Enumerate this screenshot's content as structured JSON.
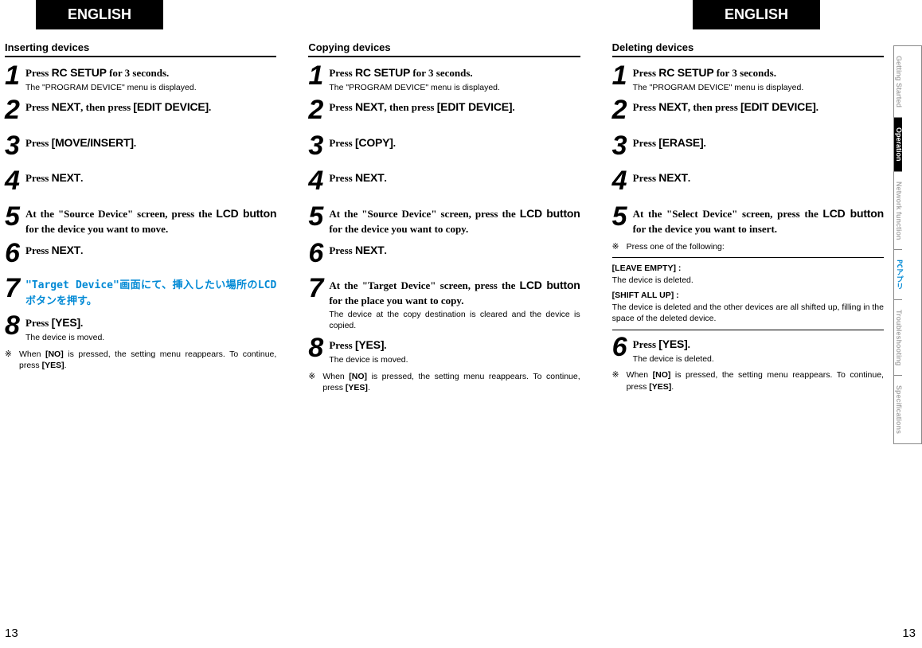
{
  "langLabel": "ENGLISH",
  "pageNumber": "13",
  "sidetabs": [
    {
      "label": "Getting Started",
      "cls": "faded"
    },
    {
      "label": "Operation",
      "cls": "active"
    },
    {
      "label": "Network function",
      "cls": "faded"
    },
    {
      "label": "PCアプリ",
      "cls": "pc"
    },
    {
      "label": "Troubleshooting",
      "cls": "faded"
    },
    {
      "label": "Specifications",
      "cls": "faded"
    }
  ],
  "col1": {
    "title": "Inserting devices",
    "s1_main": "Press RC SETUP for 3 seconds.",
    "s1_sub": "The \"PROGRAM DEVICE\" menu is displayed.",
    "s2_main": "Press NEXT, then press [EDIT DEVICE].",
    "s3_main": "Press [MOVE/INSERT].",
    "s4_main": "Press NEXT.",
    "s5_main": "At the \"Source Device\" screen, press the LCD button for the device you want to move.",
    "s6_main": "Press NEXT.",
    "s7_jp": "\"Target Device\"画面にて、挿入したい場所のLCDボタンを押す。",
    "s8_main": "Press [YES].",
    "s8_sub": "The device is moved.",
    "note": "When [NO] is pressed, the setting menu reappears. To continue, press [YES]."
  },
  "col2": {
    "title": "Copying devices",
    "s1_main": "Press RC SETUP for 3 seconds.",
    "s1_sub": "The \"PROGRAM DEVICE\" menu is displayed.",
    "s2_main": "Press NEXT, then press [EDIT DEVICE].",
    "s3_main": "Press [COPY].",
    "s4_main": "Press NEXT.",
    "s5_main": "At the \"Source Device\" screen, press the LCD button for the device you want to copy.",
    "s6_main": "Press NEXT.",
    "s7_main": "At the \"Target Device\" screen, press the LCD button for the place you want to copy.",
    "s7_sub": "The device at the copy destination is cleared and the device is copied.",
    "s8_main": "Press [YES].",
    "s8_sub": "The device is moved.",
    "note": "When [NO] is pressed, the setting menu reappears. To continue, press [YES]."
  },
  "col3": {
    "title": "Deleting devices",
    "s1_main": "Press RC SETUP for 3 seconds.",
    "s1_sub": "The \"PROGRAM DEVICE\" menu is displayed.",
    "s2_main": "Press NEXT, then press [EDIT DEVICE].",
    "s3_main": "Press [ERASE].",
    "s4_main": "Press NEXT.",
    "s5_main": "At the \"Select Device\" screen, press the LCD button for the device you want to insert.",
    "optnote": "Press one of the following:",
    "opt1_label": "[LEAVE EMPTY] :",
    "opt1_text": "The device is deleted.",
    "opt2_label": "[SHIFT ALL UP] :",
    "opt2_text": "The device is deleted and the other devices are all shifted up, filling in the space of the deleted device.",
    "s6_main": "Press [YES].",
    "s6_sub": "The device is deleted.",
    "note": "When [NO] is pressed, the setting menu reappears. To continue, press [YES]."
  },
  "noteMark": "※"
}
